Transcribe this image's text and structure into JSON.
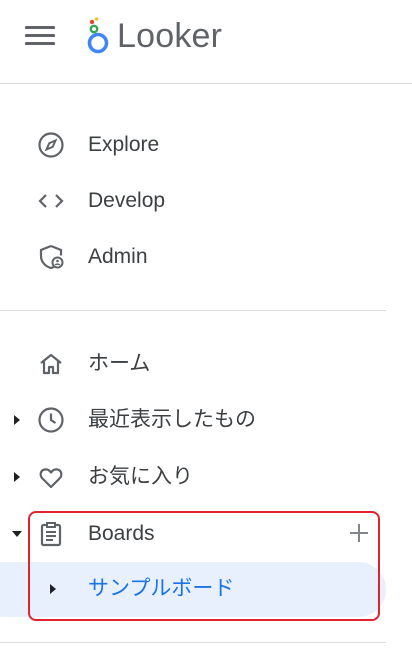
{
  "header": {
    "menu_icon": "hamburger-menu-icon",
    "logo_icon": "looker-logo-icon",
    "logo_text": "Looker"
  },
  "nav_primary": [
    {
      "label": "Explore",
      "icon": "compass-icon"
    },
    {
      "label": "Develop",
      "icon": "code-icon"
    },
    {
      "label": "Admin",
      "icon": "shield-admin-icon"
    }
  ],
  "nav_secondary": [
    {
      "label": "ホーム",
      "icon": "home-icon"
    },
    {
      "label": "最近表示したもの",
      "icon": "clock-icon"
    },
    {
      "label": "お気に入り",
      "icon": "heart-icon"
    },
    {
      "label": "Boards",
      "icon": "clipboard-icon",
      "add_icon": "plus-icon"
    }
  ],
  "boards": {
    "items": [
      {
        "label": "サンプルボード",
        "selected": true
      }
    ]
  },
  "colors": {
    "text": "#3c4043",
    "icon": "#5f6368",
    "selected_text": "#1a73e8",
    "selected_bg": "#e8f0fe",
    "highlight_border": "#e0232e",
    "divider": "#dadce0"
  }
}
